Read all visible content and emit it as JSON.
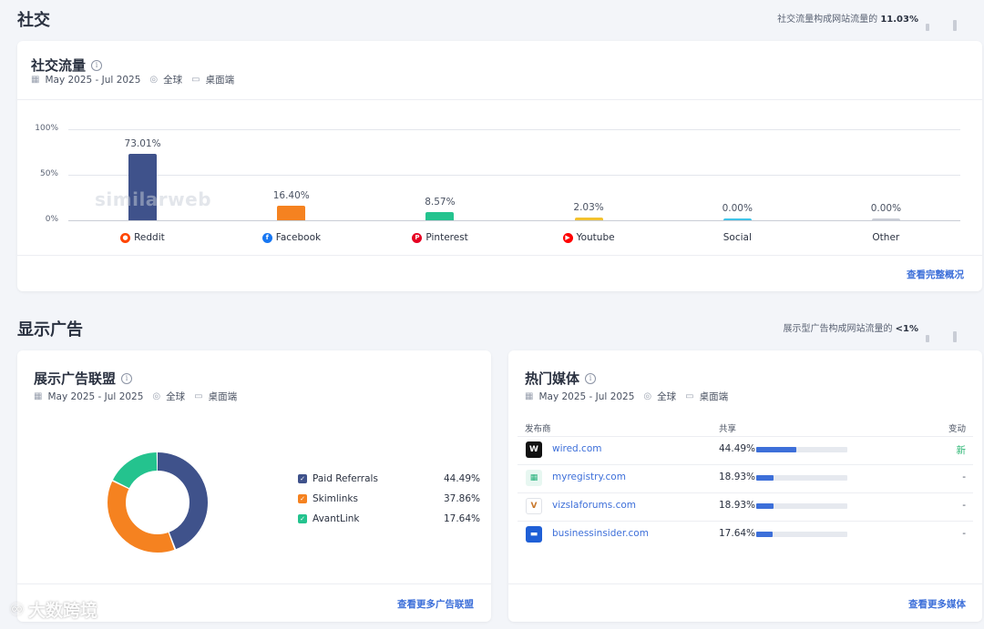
{
  "social": {
    "section_title": "社交",
    "note_prefix": "社交流量构成网站流量的",
    "note_value": "11.03%",
    "card_title": "社交流量",
    "date_range": "May 2025 - Jul 2025",
    "region": "全球",
    "device": "桌面端",
    "link": "查看完整概况",
    "watermark": "similarweb",
    "chart_data": {
      "type": "bar",
      "categories": [
        "Reddit",
        "Facebook",
        "Pinterest",
        "Youtube",
        "Social",
        "Other"
      ],
      "values": [
        73.01,
        16.4,
        8.57,
        2.03,
        0.0,
        0.0
      ],
      "value_labels": [
        "73.01%",
        "16.40%",
        "8.57%",
        "2.03%",
        "0.00%",
        "0.00%"
      ],
      "colors": [
        "#3f528b",
        "#f58220",
        "#24c38e",
        "#f2c12e",
        "#3fc3e8",
        "#c9cdd6"
      ],
      "ytick_labels": [
        "100%",
        "50%",
        "0%"
      ],
      "ylim": [
        0,
        100
      ],
      "grid": true
    }
  },
  "display": {
    "section_title": "显示广告",
    "note_prefix": "展示型广告构成网站流量的",
    "note_value": "<1%",
    "networks": {
      "card_title": "展示广告联盟",
      "date_range": "May 2025 - Jul 2025",
      "region": "全球",
      "device": "桌面端",
      "link": "查看更多广告联盟",
      "chart_data": {
        "type": "pie",
        "labels": [
          "Paid Referrals",
          "Skimlinks",
          "AvantLink"
        ],
        "values": [
          44.49,
          37.86,
          17.64
        ],
        "value_labels": [
          "44.49%",
          "37.86%",
          "17.64%"
        ],
        "colors": [
          "#3f528b",
          "#f58220",
          "#24c38e"
        ]
      }
    },
    "publishers": {
      "card_title": "热门媒体",
      "date_range": "May 2025 - Jul 2025",
      "region": "全球",
      "device": "桌面端",
      "col_publisher": "发布商",
      "col_share": "共享",
      "col_change": "变动",
      "link": "查看更多媒体",
      "rows": [
        {
          "name": "wired.com",
          "share": "44.49%",
          "value": 44.49,
          "change": "新"
        },
        {
          "name": "myregistry.com",
          "share": "18.93%",
          "value": 18.93,
          "change": "-"
        },
        {
          "name": "vizslaforums.com",
          "share": "18.93%",
          "value": 18.93,
          "change": "-"
        },
        {
          "name": "businessinsider.com",
          "share": "17.64%",
          "value": 17.64,
          "change": "-"
        }
      ]
    }
  },
  "brand_mark": "大数跨境"
}
